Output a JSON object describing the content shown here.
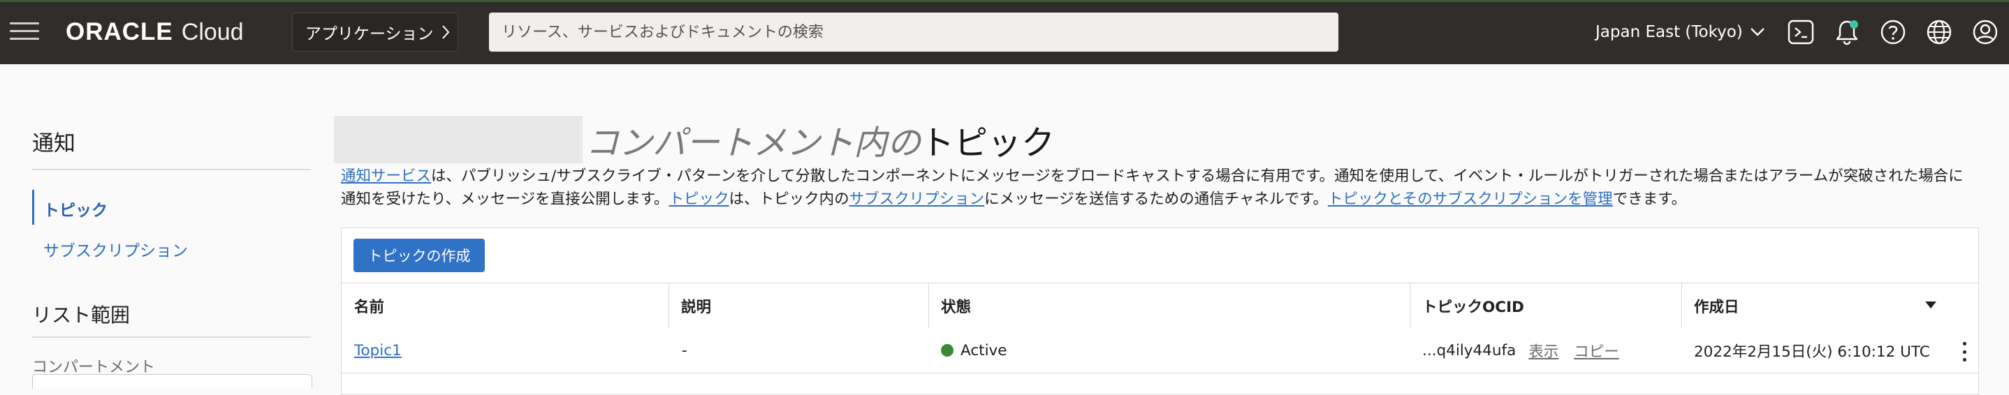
{
  "header": {
    "logo_brand": "ORACLE",
    "logo_product": "Cloud",
    "apps_button": "アプリケーション",
    "search_placeholder": "リソース、サービスおよびドキュメントの検索",
    "region": "Japan East (Tokyo)",
    "icons": [
      "menu-icon",
      "chevron-right-icon",
      "chevron-down-icon",
      "cloud-shell-icon",
      "bell-icon",
      "help-icon",
      "globe-icon",
      "user-icon"
    ],
    "colors": {
      "bar": "#312d2a",
      "notification_dot": "#3fc5a5"
    }
  },
  "sidebar": {
    "title": "通知",
    "items": [
      {
        "label": "トピック",
        "active": true
      },
      {
        "label": "サブスクリプション",
        "active": false
      }
    ],
    "scope_title": "リスト範囲",
    "compartment_label": "コンパートメント"
  },
  "main": {
    "title_italic": "コンパートメント内の",
    "title_plain": "トピック",
    "description": {
      "link_notifications": "通知サービス",
      "text1": "は、パブリッシュ/サブスクライブ・パターンを介して分散したコンポーネントにメッセージをブロードキャストする場合に有用です。通知を使用して、イベント・ルールがトリガーされた場合またはアラームが突破された場合に通知を受けたり、メッセージを直接公開します。",
      "link_topic": "トピック",
      "text2": "は、トピック内の",
      "link_subscription": "サブスクリプション",
      "text3": "にメッセージを送信するための通信チャネルです。",
      "link_manage": "トピックとそのサブスクリプションを管理",
      "text4": "できます。"
    },
    "create_button": "トピックの作成",
    "table": {
      "columns": [
        "名前",
        "説明",
        "状態",
        "トピックOCID",
        "作成日"
      ],
      "rows": [
        {
          "name": "Topic1",
          "description": "-",
          "state": "Active",
          "ocid": "...q4ily44ufa",
          "ocid_show": "表示",
          "ocid_copy": "コピー",
          "created": "2022年2月15日(火) 6:10:12 UTC"
        }
      ]
    },
    "colors": {
      "link": "#2f6fc1",
      "button": "#2f72c6",
      "active_state": "#3a8a34"
    }
  }
}
